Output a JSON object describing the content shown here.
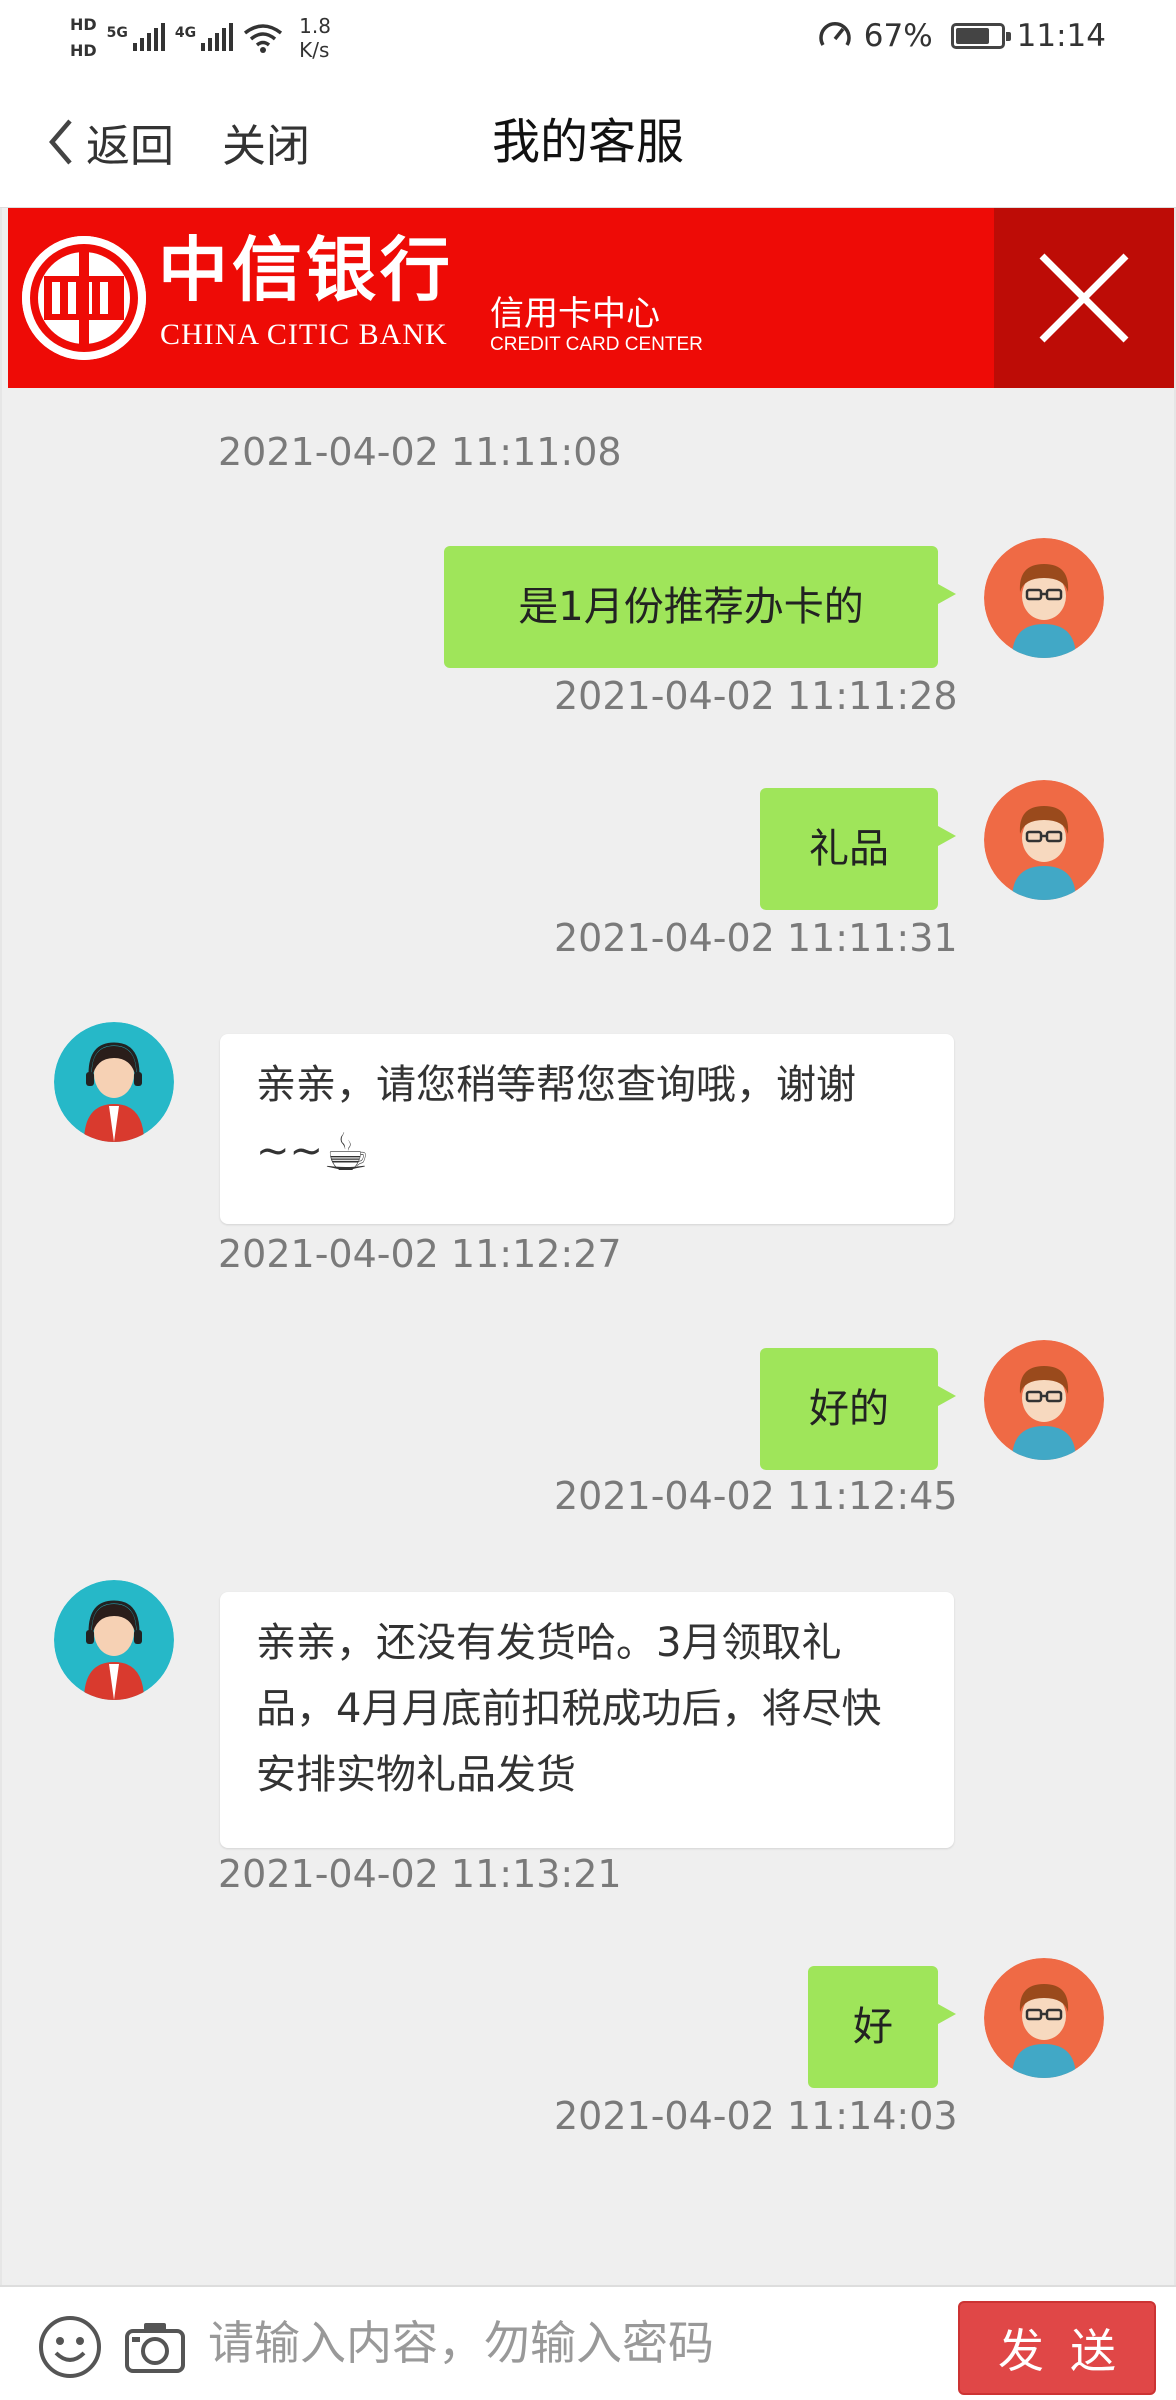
{
  "status_bar": {
    "hd1": "HD",
    "hd2": "HD",
    "net1": "5G",
    "net2": "4G",
    "speed_value": "1.8",
    "speed_unit": "K/s",
    "battery": "67%",
    "time": "11:14"
  },
  "nav": {
    "back_label": "返回",
    "close_label": "关闭",
    "title": "我的客服"
  },
  "banner": {
    "bank_name_cn": "中信银行",
    "bank_name_en": "CHINA CITIC BANK",
    "center_cn": "信用卡中心",
    "center_en": "CREDIT CARD CENTER",
    "bg_color": "#ee0b06",
    "close_bg_color": "#bd0c06"
  },
  "messages": [
    {
      "id": "m0",
      "side": "agent",
      "text": "",
      "time": "2021-04-02 11:11:08"
    },
    {
      "id": "m1",
      "side": "user",
      "text": "是1月份推荐办卡的",
      "time": "2021-04-02 11:11:28"
    },
    {
      "id": "m2",
      "side": "user",
      "text": "礼品",
      "time": "2021-04-02 11:11:31"
    },
    {
      "id": "m3",
      "side": "agent",
      "text": "亲亲，请您稍等帮您查询哦，谢谢",
      "text2": "~~",
      "emoji": "coffee-cup",
      "time": "2021-04-02 11:12:27"
    },
    {
      "id": "m4",
      "side": "user",
      "text": "好的",
      "time": "2021-04-02 11:12:45"
    },
    {
      "id": "m5",
      "side": "agent",
      "text": "亲亲，还没有发货哈。3月领取礼品，4月月底前扣税成功后，将尽快安排实物礼品发货",
      "time": "2021-04-02 11:13:21"
    },
    {
      "id": "m6",
      "side": "user",
      "text": "好",
      "time": "2021-04-02 11:14:03"
    }
  ],
  "input_bar": {
    "placeholder": "请输入内容，勿输入密码",
    "value": "",
    "send_label": "发送",
    "emoji_icon": "smiley-icon",
    "camera_icon": "camera-icon"
  },
  "colors": {
    "user_bubble": "#9fe55a",
    "agent_avatar_bg": "#26b8c8",
    "user_avatar_bg": "#ef6a45",
    "send_button": "#e04747"
  }
}
